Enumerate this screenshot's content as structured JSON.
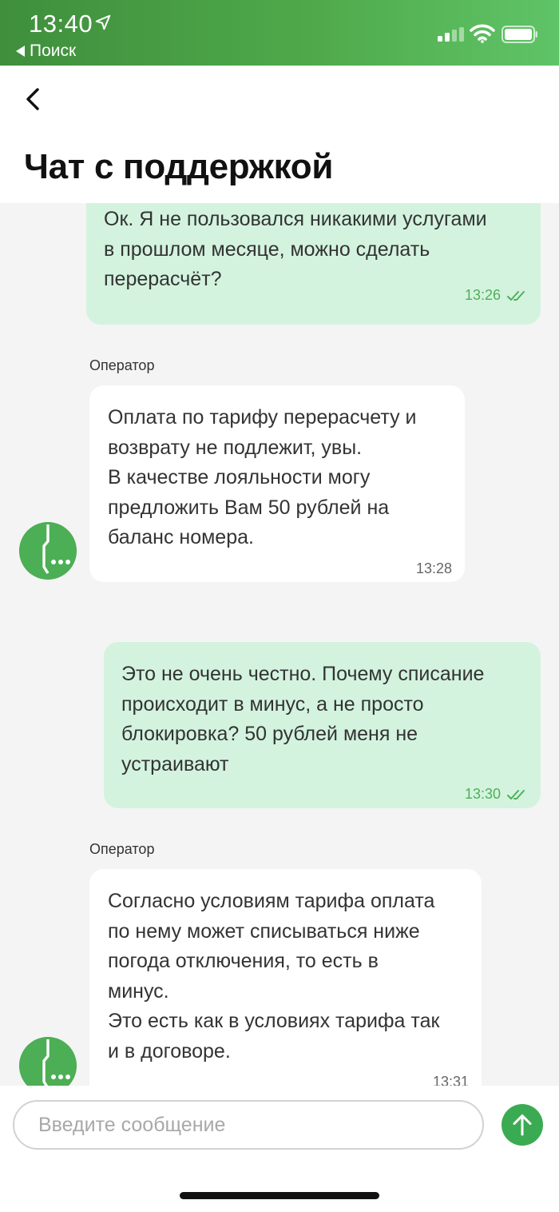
{
  "status_bar": {
    "time": "13:40",
    "back_app_label": "Поиск",
    "icons": [
      "location-arrow-icon",
      "cellular-signal-icon",
      "wifi-icon",
      "battery-icon"
    ]
  },
  "header": {
    "title": "Чат с поддержкой",
    "back_icon": "chevron-left-icon"
  },
  "messages": [
    {
      "sender": "user",
      "text": "Ок. Я не пользовался никакими услугами\nв прошлом месяце, можно сделать\nперерасчёт?",
      "time": "13:26",
      "status_icon": "double-check-icon"
    },
    {
      "sender": "operator",
      "label": "Оператор",
      "text": "Оплата по тарифу перерасчету и\nвозврату не подлежит, увы.\nВ качестве лояльности могу\nпредложить Вам 50 рублей на\nбаланс номера.",
      "time": "13:28"
    },
    {
      "sender": "user",
      "text": "Это не очень честно. Почему списание\nпроисходит в минус, а не просто\nблокировка? 50 рублей меня не\nустраивают",
      "time": "13:30",
      "status_icon": "double-check-icon"
    },
    {
      "sender": "operator",
      "label": "Оператор",
      "text": "Согласно условиям тарифа оплата\nпо нему может списываться ниже\nпогода отключения, то есть в\nминус.\nЭто есть как в условиях тарифа так\nи в договоре.",
      "time": "13:31"
    }
  ],
  "input": {
    "placeholder": "Введите сообщение",
    "value": ""
  },
  "send_button": {
    "icon": "arrow-up-icon"
  },
  "colors": {
    "brand_green": "#4cae55",
    "user_bubble": "#d3f3de",
    "operator_bubble": "#ffffff",
    "check_green": "#4fb05a",
    "background": "#f4f4f4"
  }
}
